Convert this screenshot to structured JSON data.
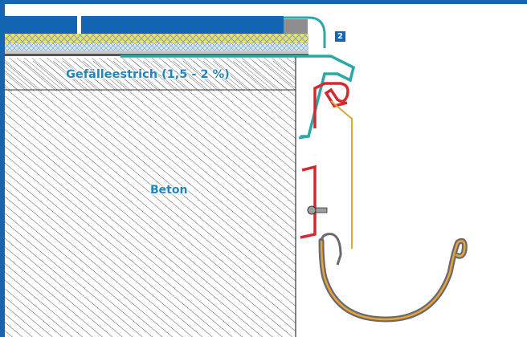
{
  "labels": {
    "screed": "Gefälleestrich (1,5 - 2 %)",
    "concrete": "Beton"
  },
  "badge": {
    "number": "2"
  },
  "colors": {
    "frame_blue": "#1565b5",
    "label_blue": "#1f86bd",
    "teal_profile": "#2ba7a8",
    "red_hook": "#d42a2f",
    "gutter_orange": "#e8a33c",
    "gray": "#8e8e8e",
    "insulation_yellow": "#e6d85a"
  }
}
